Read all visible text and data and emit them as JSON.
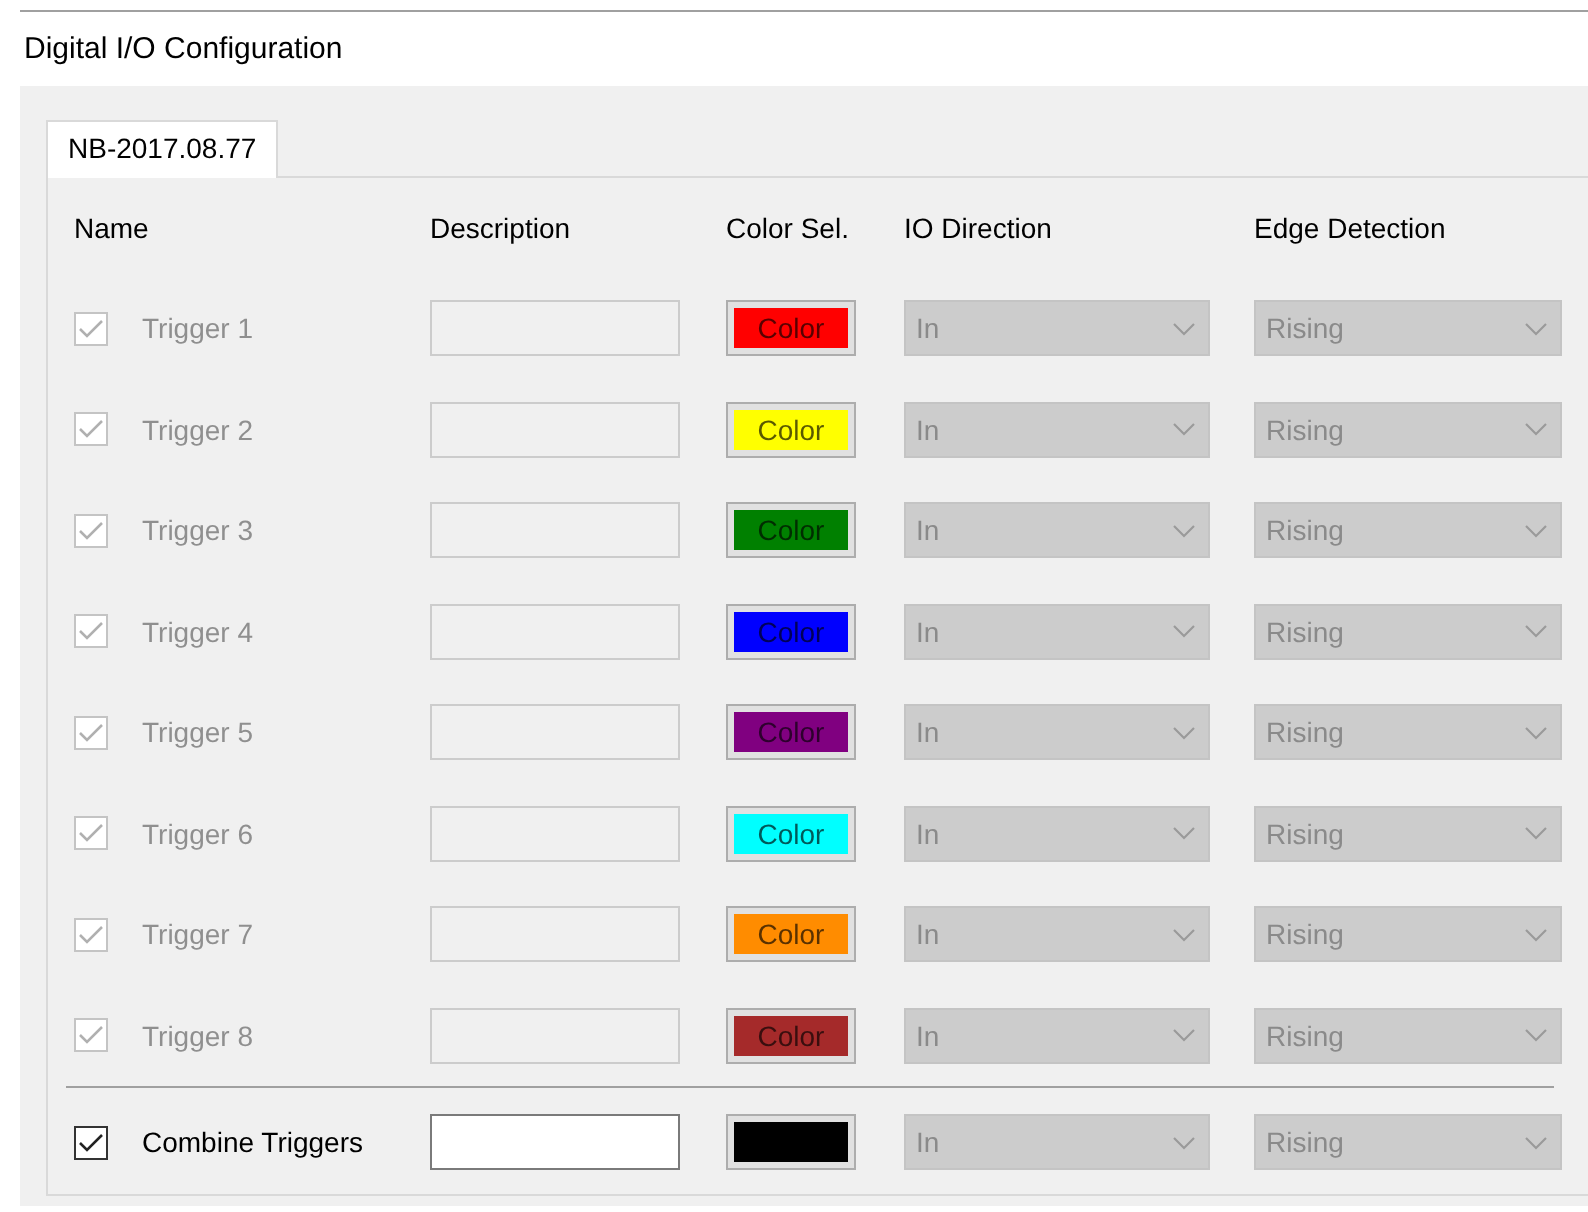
{
  "title": "Digital I/O Configuration",
  "tabs": [
    {
      "label": "NB-2017.08.77",
      "selected": true
    }
  ],
  "columns": [
    "Name",
    "Description",
    "Color Sel.",
    "IO Direction",
    "Edge Detection"
  ],
  "triggers": [
    {
      "name": "Trigger 1",
      "checked": true,
      "enabled": false,
      "color": "#ff0000",
      "color_label": "Color",
      "io_direction": "In",
      "edge_detection": "Rising"
    },
    {
      "name": "Trigger 2",
      "checked": true,
      "enabled": false,
      "color": "#ffff00",
      "color_label": "Color",
      "io_direction": "In",
      "edge_detection": "Rising"
    },
    {
      "name": "Trigger 3",
      "checked": true,
      "enabled": false,
      "color": "#008000",
      "color_label": "Color",
      "io_direction": "In",
      "edge_detection": "Rising"
    },
    {
      "name": "Trigger 4",
      "checked": true,
      "enabled": false,
      "color": "#0000ff",
      "color_label": "Color",
      "io_direction": "In",
      "edge_detection": "Rising"
    },
    {
      "name": "Trigger 5",
      "checked": true,
      "enabled": false,
      "color": "#800080",
      "color_label": "Color",
      "io_direction": "In",
      "edge_detection": "Rising"
    },
    {
      "name": "Trigger 6",
      "checked": true,
      "enabled": false,
      "color": "#00ffff",
      "color_label": "Color",
      "io_direction": "In",
      "edge_detection": "Rising"
    },
    {
      "name": "Trigger 7",
      "checked": true,
      "enabled": false,
      "color": "#ff8c00",
      "color_label": "Color",
      "io_direction": "In",
      "edge_detection": "Rising"
    },
    {
      "name": "Trigger 8",
      "checked": true,
      "enabled": false,
      "color": "#a52a2a",
      "color_label": "Color",
      "io_direction": "In",
      "edge_detection": "Rising"
    }
  ],
  "combine": {
    "name": "Combine Triggers",
    "checked": true,
    "enabled": true,
    "color": "#000000",
    "io_direction": "In",
    "edge_detection": "Rising"
  }
}
